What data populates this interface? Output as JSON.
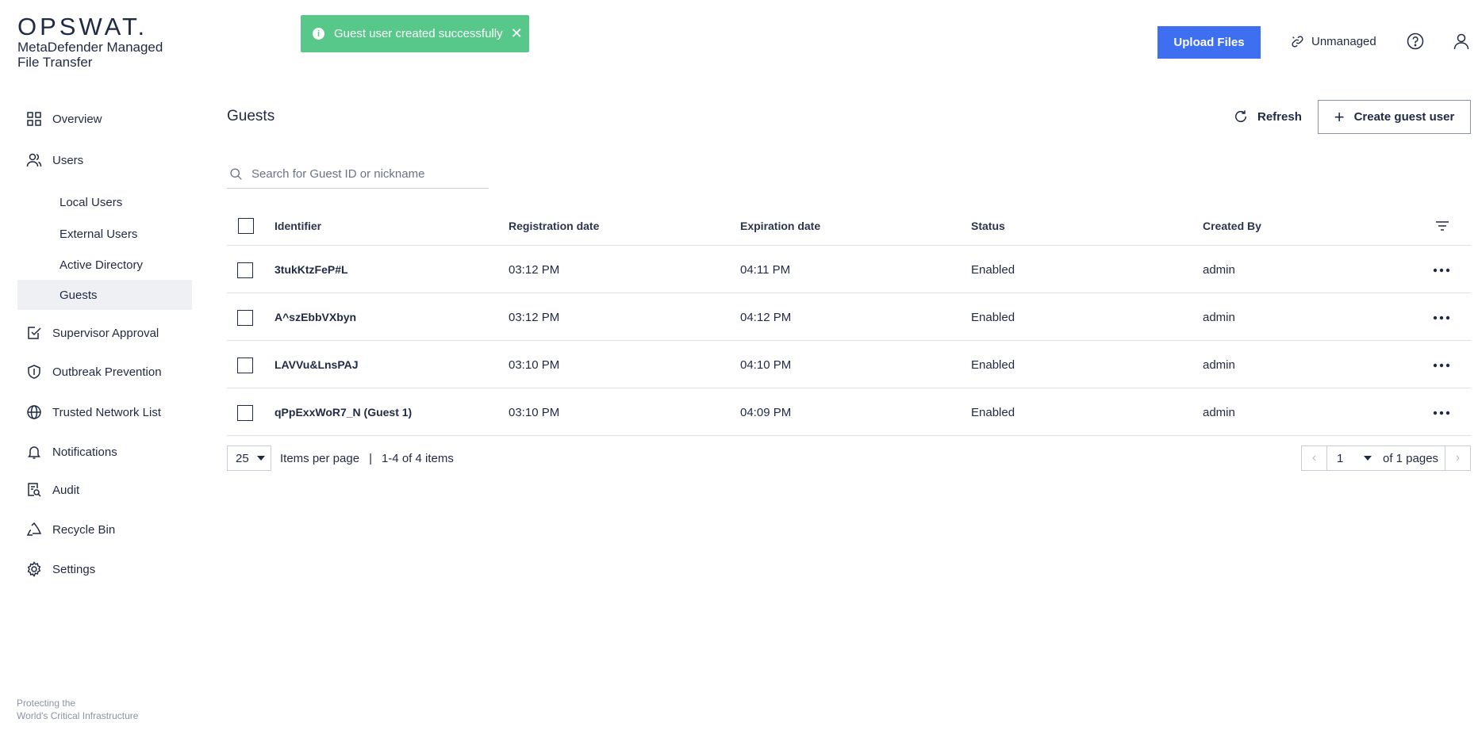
{
  "brand": {
    "logo": "OPSWAT.",
    "product": "MetaDefender Managed File Transfer",
    "tagline_line1": "Protecting the",
    "tagline_line2": "World's Critical Infrastructure"
  },
  "toast": {
    "message": "Guest user created successfully",
    "close_symbol": "✕",
    "color": "#58c88a"
  },
  "header": {
    "upload_label": "Upload Files",
    "mode_label": "Unmanaged",
    "accent": "#3d6ff0"
  },
  "sidebar": {
    "items": [
      {
        "label": "Overview",
        "icon": "grid-icon"
      },
      {
        "label": "Users",
        "icon": "users-icon"
      },
      {
        "label": "Supervisor Approval",
        "icon": "approval-icon"
      },
      {
        "label": "Outbreak Prevention",
        "icon": "shield-icon"
      },
      {
        "label": "Trusted Network List",
        "icon": "globe-icon"
      },
      {
        "label": "Notifications",
        "icon": "bell-icon"
      },
      {
        "label": "Audit",
        "icon": "audit-icon"
      },
      {
        "label": "Recycle Bin",
        "icon": "recycle-icon"
      },
      {
        "label": "Settings",
        "icon": "gear-icon"
      }
    ],
    "user_subitems": [
      {
        "label": "Local Users"
      },
      {
        "label": "External Users"
      },
      {
        "label": "Active Directory"
      },
      {
        "label": "Guests",
        "active": true
      }
    ]
  },
  "main": {
    "title": "Guests",
    "refresh_label": "Refresh",
    "create_label": "Create guest user",
    "search_placeholder": "Search for Guest ID or nickname",
    "columns": {
      "identifier": "Identifier",
      "registration": "Registration date",
      "expiration": "Expiration date",
      "status": "Status",
      "created_by": "Created By"
    },
    "rows": [
      {
        "identifier": "3tukKtzFeP#L",
        "registration": "03:12 PM",
        "expiration": "04:11 PM",
        "status": "Enabled",
        "created_by": "admin"
      },
      {
        "identifier": "A^szEbbVXbyn",
        "registration": "03:12 PM",
        "expiration": "04:12 PM",
        "status": "Enabled",
        "created_by": "admin"
      },
      {
        "identifier": "LAVVu&LnsPAJ",
        "registration": "03:10 PM",
        "expiration": "04:10 PM",
        "status": "Enabled",
        "created_by": "admin"
      },
      {
        "identifier": "qPpExxWoR7_N (Guest 1)",
        "registration": "03:10 PM",
        "expiration": "04:09 PM",
        "status": "Enabled",
        "created_by": "admin"
      }
    ]
  },
  "pagination": {
    "page_size": "25",
    "per_page_label": "Items per page",
    "separator": "|",
    "range_label": "1-4 of 4 items",
    "current_page": "1",
    "of_pages_label": "of 1 pages",
    "prev_symbol": "‹",
    "next_symbol": "›"
  }
}
